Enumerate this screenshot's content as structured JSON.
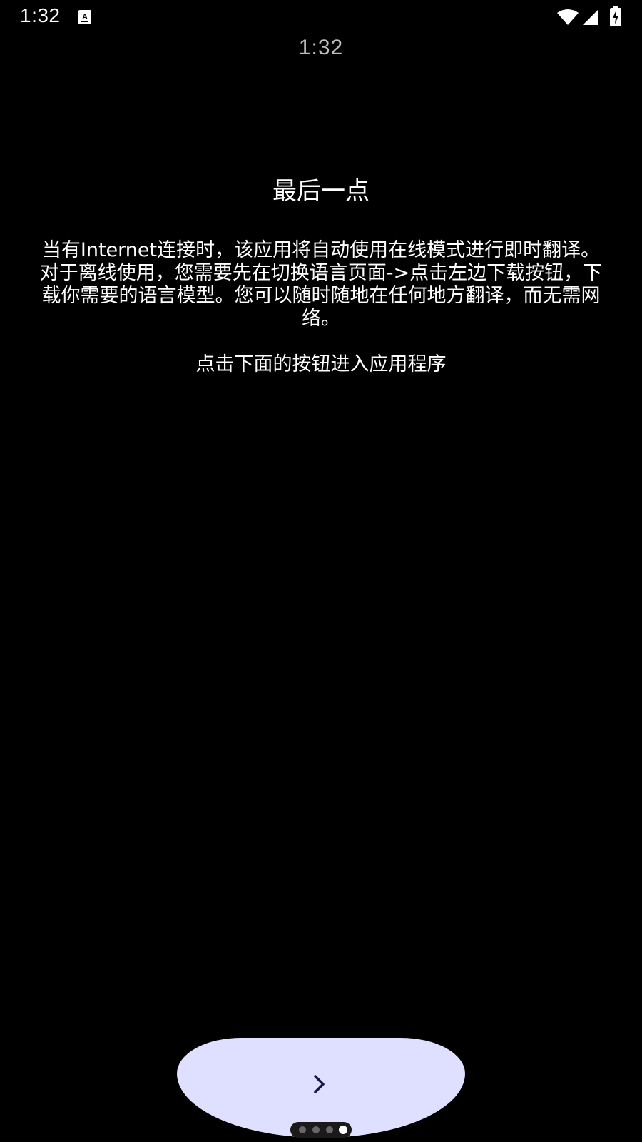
{
  "status_bar": {
    "time": "1:32",
    "notification_icon": "keyboard-a-icon",
    "wifi_icon": "wifi-icon",
    "signal_icon": "signal-icon",
    "battery_icon": "battery-charging-icon"
  },
  "header": {
    "clock": "1:32"
  },
  "content": {
    "title": "最后一点",
    "body": "当有Internet连接时，该应用将自动使用在线模式进行即时翻译。对于离线使用，您需要先在切换语言页面->点击左边下载按钮，下载你需要的语言模型。您可以随时随地在任何地方翻译，而无需网络。",
    "hint": "点击下面的按钮进入应用程序"
  },
  "footer": {
    "next_button_icon": "chevron-right-icon",
    "page_count": 4,
    "current_page": 4
  },
  "colors": {
    "background": "#000000",
    "button": "#dfe0ff",
    "chevron": "#1a1446",
    "dot_inactive": "#666666",
    "dot_active": "#ffffff"
  }
}
